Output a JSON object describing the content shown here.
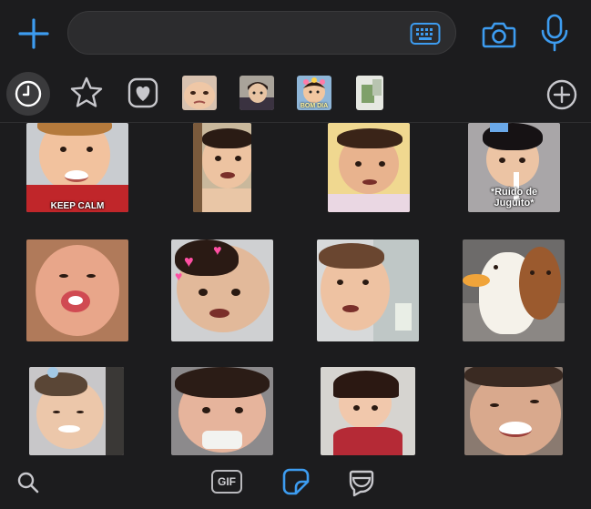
{
  "composer": {
    "placeholder": "",
    "value": ""
  },
  "icons": {
    "add": "plus-icon",
    "keyboard": "keyboard-icon",
    "camera": "camera-icon",
    "mic": "microphone-icon",
    "recent": "clock-icon",
    "favorites": "star-icon",
    "favorite_pack": "heart-icon",
    "add_pack": "plus-circle-icon",
    "search": "search-icon",
    "gif": "gif-icon",
    "sticker": "sticker-icon",
    "emoji": "emoji-icon"
  },
  "tabs": {
    "selected": "recent",
    "packs": [
      {
        "name": "pack-1"
      },
      {
        "name": "pack-2"
      },
      {
        "name": "pack-3",
        "caption": "BOM DIA"
      },
      {
        "name": "pack-4"
      }
    ]
  },
  "stickers": [
    {
      "caption": "KEEP CALM"
    },
    {
      "caption": ""
    },
    {
      "caption": ""
    },
    {
      "caption": "*Ruido de Juguito*"
    },
    {
      "caption": ""
    },
    {
      "caption": ""
    },
    {
      "caption": ""
    },
    {
      "caption": ""
    },
    {
      "caption": ""
    },
    {
      "caption": ""
    },
    {
      "caption": ""
    },
    {
      "caption": ""
    }
  ],
  "bottom": {
    "gif_label": "GIF",
    "selected": "sticker"
  },
  "colors": {
    "accent": "#3d9cf0",
    "background": "#1c1c1e",
    "field": "#2c2c2e"
  }
}
